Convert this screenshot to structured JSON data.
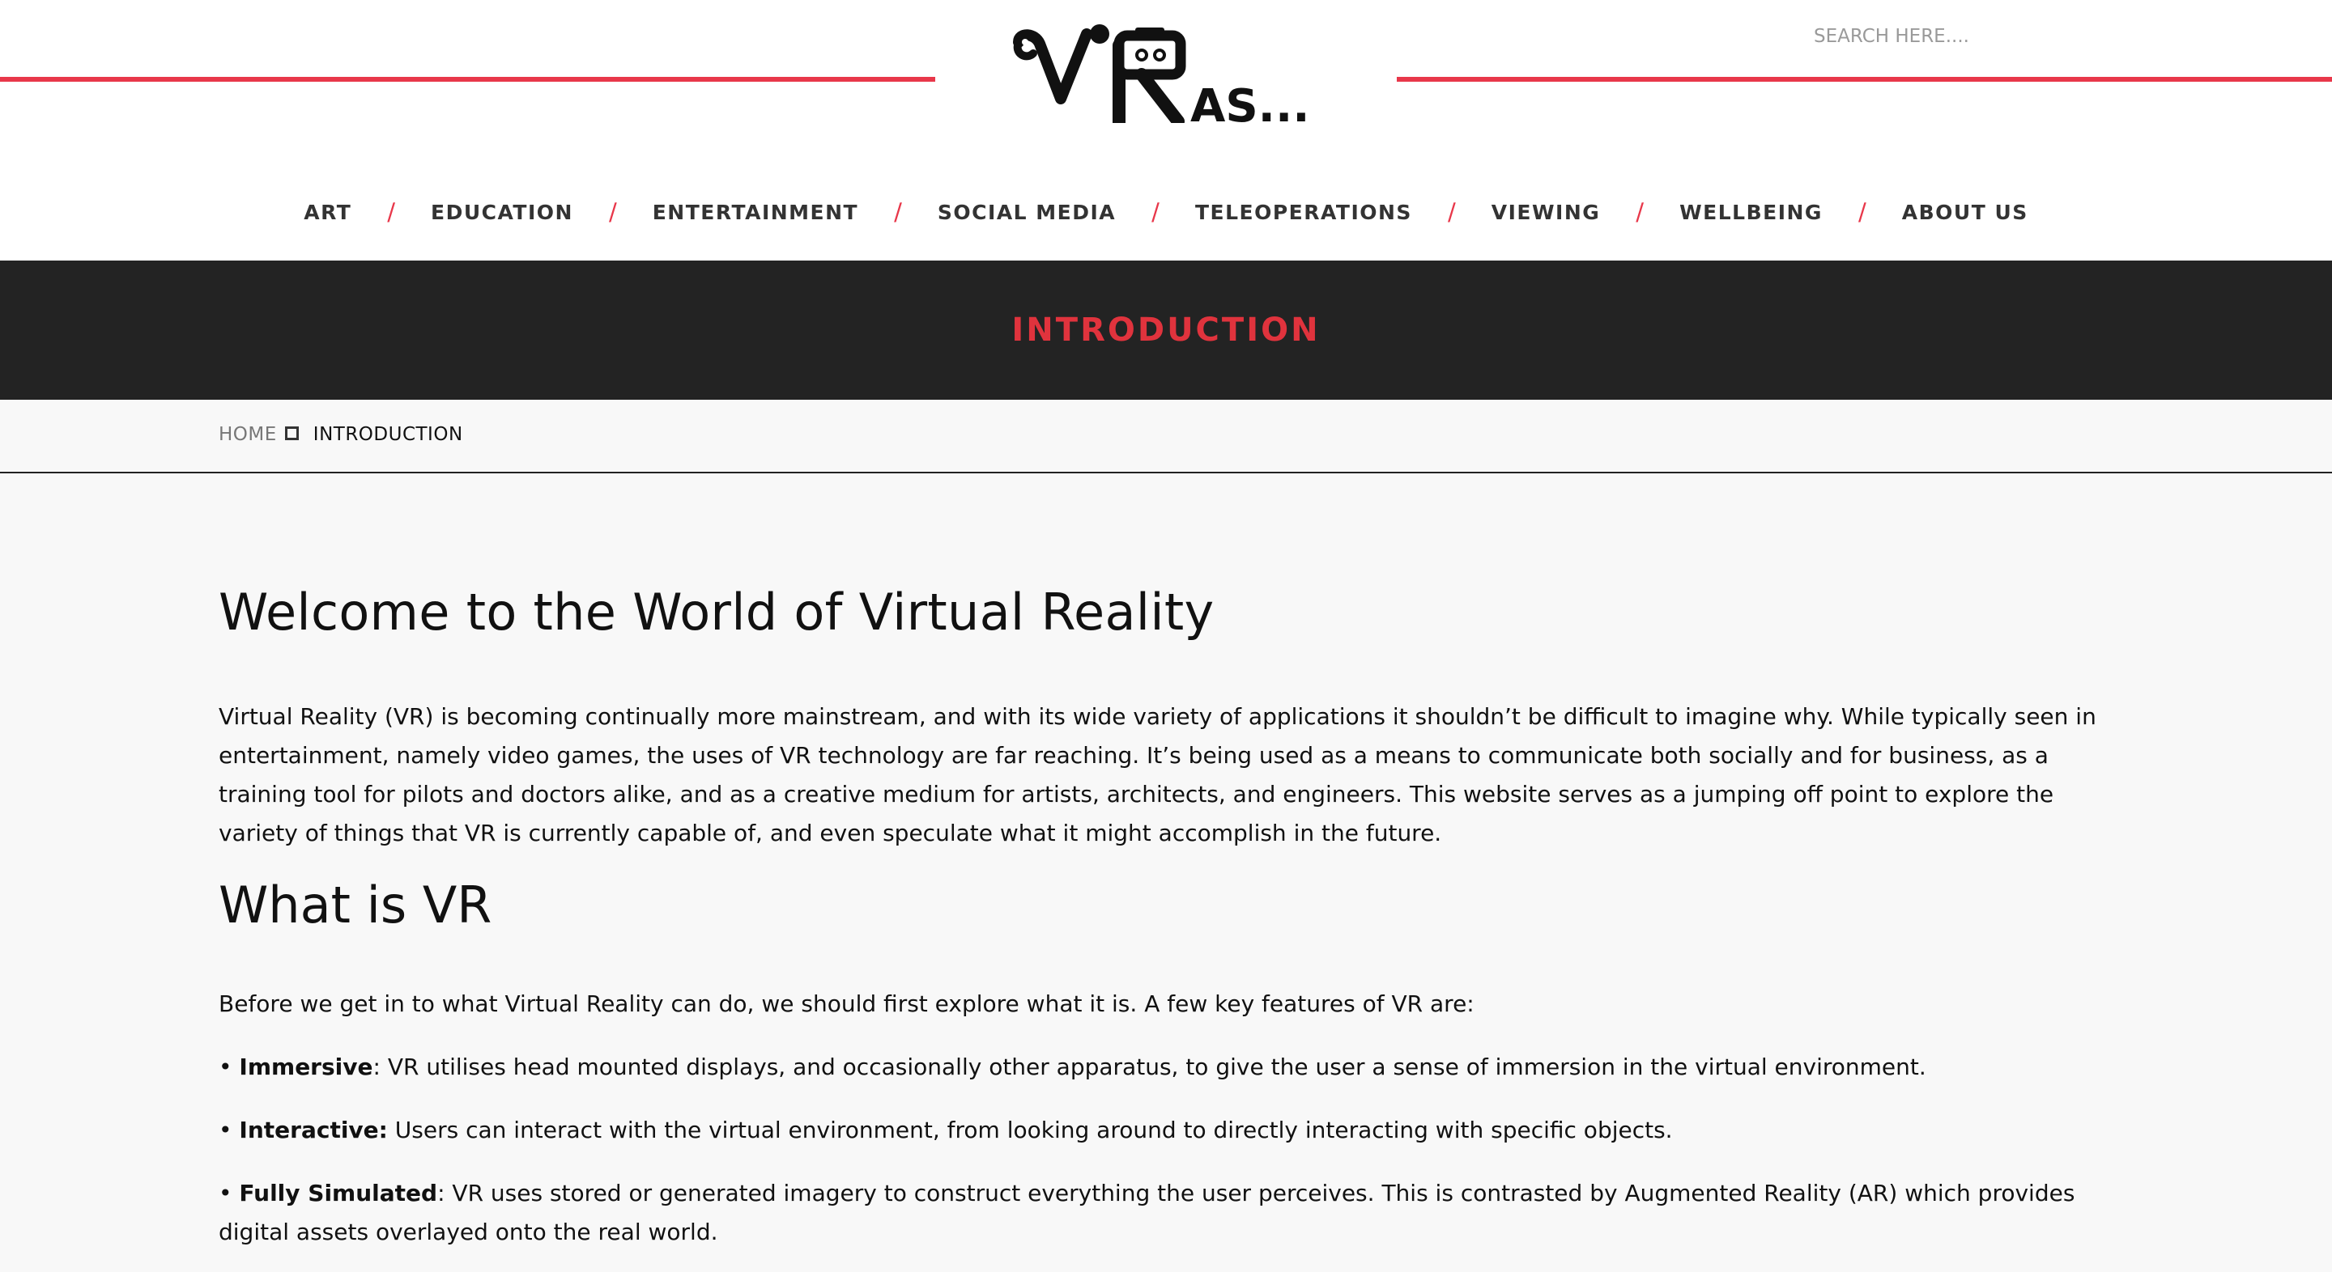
{
  "header": {
    "logo_text": "VR AS...",
    "search_placeholder": "SEARCH HERE....",
    "nav": [
      "ART",
      "EDUCATION",
      "ENTERTAINMENT",
      "SOCIAL MEDIA",
      "TELEOPERATIONS",
      "VIEWING",
      "WELLBEING",
      "ABOUT US"
    ],
    "nav_separator": "/"
  },
  "banner": {
    "title": "INTRODUCTION"
  },
  "breadcrumb": {
    "home": "HOME",
    "current": "INTRODUCTION"
  },
  "main": {
    "title": "Welcome to the World of Virtual Reality",
    "intro": "Virtual Reality (VR) is becoming continually more mainstream, and with its wide variety of applications it shouldn’t be difficult to imagine why. While typically seen in entertainment, namely video games, the uses of VR technology are far reaching. It’s being used as a means to communicate both socially and for business, as a training tool for pilots and doctors alike, and as a creative medium for artists, architects, and engineers. This website serves as a jumping off point to explore the variety of things that VR is currently capable of, and even speculate what it might accomplish in the future.",
    "subtitle": "What is VR",
    "lead": "Before we get in to what Virtual Reality can do, we should first explore what it is. A few key features of VR are:",
    "features": [
      {
        "bullet": "• ",
        "term": "Immersive",
        "text": ": VR utilises head mounted displays, and occasionally other apparatus, to give the user a sense of immersion in the virtual environment."
      },
      {
        "bullet": "• ",
        "term": "Interactive:",
        "text": " Users can interact with the virtual environment, from looking around to directly interacting with specific objects."
      },
      {
        "bullet": "• ",
        "term": "Fully Simulated",
        "text": ": VR uses stored or generated imagery to construct everything the user perceives. This is contrasted by Augmented Reality (AR) which provides digital assets overlayed onto the real world."
      }
    ]
  },
  "colors": {
    "accent_red": "#e8374a",
    "banner_bg": "#232323",
    "banner_text": "#e0333d",
    "page_bg": "#f8f8f8"
  }
}
